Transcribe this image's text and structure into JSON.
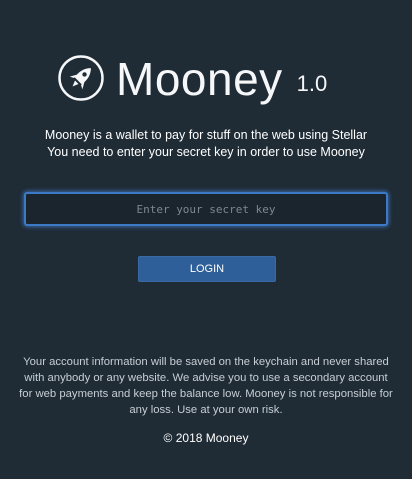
{
  "app": {
    "name": "Mooney",
    "version": "1.0"
  },
  "intro": {
    "line1": "Mooney is a wallet to pay for stuff on the web using Stellar",
    "line2": "You need to enter your secret key in order to use Mooney"
  },
  "secret_key_input": {
    "placeholder": "Enter your secret key",
    "value": ""
  },
  "login_button": {
    "label": "LOGIN"
  },
  "disclaimer": {
    "line1": "Your account information will be saved on the keychain and never shared",
    "line2": "with anybody or any website. We advise you to use a secondary account",
    "line3": "for web payments and keep the balance low. Mooney is not responsible for",
    "line4": "any loss. Use at your own risk."
  },
  "footer": {
    "copyright": "© 2018 Mooney"
  },
  "icons": {
    "logo": "rocket-icon"
  },
  "colors": {
    "background": "#1f2b35",
    "accent": "#2f5f98",
    "input_border": "#3c79c6"
  }
}
